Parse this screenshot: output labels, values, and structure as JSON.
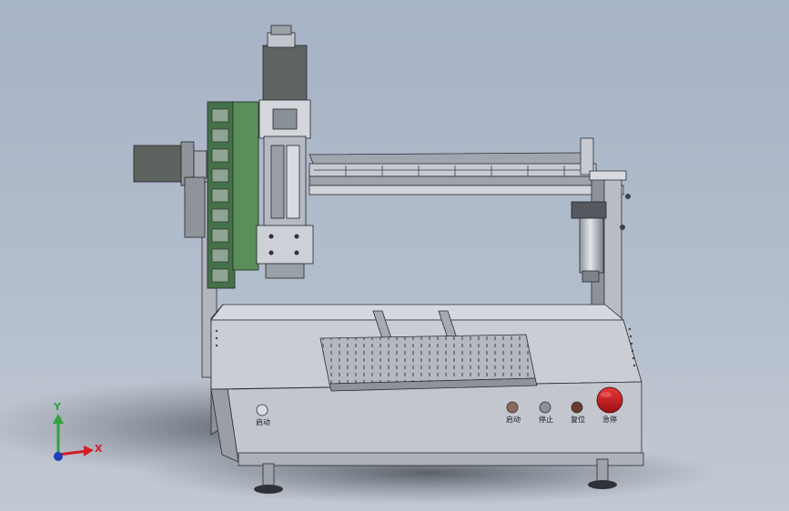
{
  "panel": {
    "buttons": [
      {
        "label": "启动"
      },
      {
        "label": "启动"
      },
      {
        "label": "停止"
      },
      {
        "label": "复位"
      },
      {
        "label": "急停"
      }
    ]
  },
  "triad": {
    "y_label": "Y",
    "x_label": "X"
  },
  "colors": {
    "background": "#a8b4c6",
    "frame": "#c9cbd6",
    "motor": "#5f6660",
    "cable_chain": "#3d6b3f",
    "emergency_stop": "#c8161d",
    "x_axis": "#d21f26",
    "y_axis": "#2fa33b",
    "z_axis": "#1f3fb8"
  },
  "icons": [
    "coordinate-triad-icon",
    "emergency-stop-icon",
    "push-button-icon"
  ]
}
